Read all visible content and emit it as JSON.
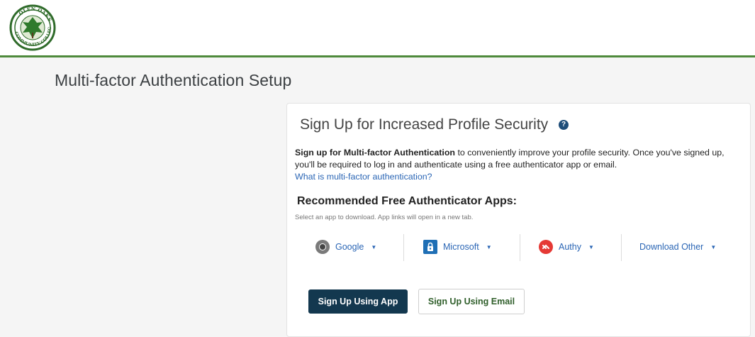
{
  "header": {
    "logo": {
      "name": "college-seal-logo",
      "lettering": "OLEN OAKS COMMUNITY COLLEGE"
    },
    "accent_color": "#4e8a3c"
  },
  "page": {
    "title": "Multi-factor Authentication Setup"
  },
  "card": {
    "title": "Sign Up for Increased Profile Security",
    "help_icon": "question-circle-icon",
    "description_bold": "Sign up for Multi-factor Authentication",
    "description_rest": " to conveniently improve your profile security. Once you've signed up, you'll be required to log in and authenticate using a free authenticator app or email.",
    "info_link": "What is multi-factor authentication?",
    "recommended_title": "Recommended Free Authenticator Apps:",
    "recommended_subtitle": "Select an app to download. App links will open in a new tab.",
    "apps": [
      {
        "label": "Google",
        "icon": "google-authenticator-icon"
      },
      {
        "label": "Microsoft",
        "icon": "microsoft-authenticator-icon"
      },
      {
        "label": "Authy",
        "icon": "authy-icon"
      },
      {
        "label": "Download Other",
        "icon": ""
      }
    ],
    "primary_button": "Sign Up Using App",
    "secondary_button": "Sign Up Using Email"
  },
  "colors": {
    "primary_button": "#13384f",
    "link": "#2b66b5",
    "secondary_button_text": "#2f5e2a"
  }
}
